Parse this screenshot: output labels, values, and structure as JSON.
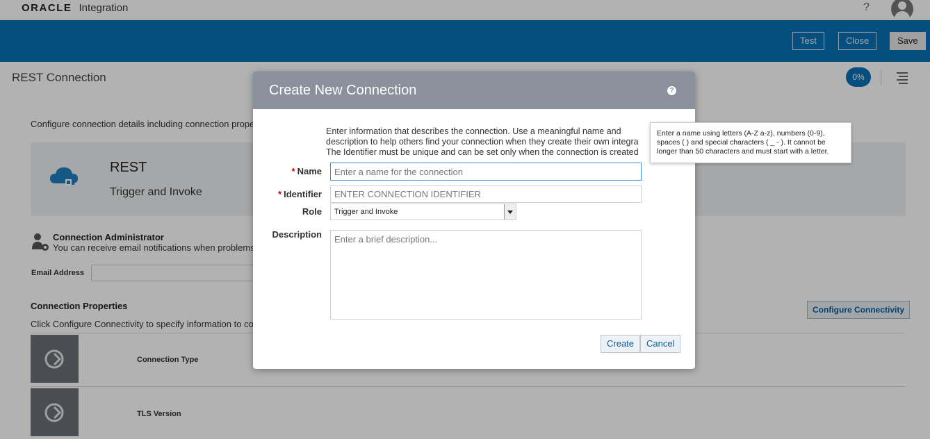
{
  "header": {
    "brand": "ORACLE",
    "product": "Integration",
    "help_label": "?"
  },
  "toolbar": {
    "test_label": "Test",
    "close_label": "Close",
    "save_label": "Save"
  },
  "page": {
    "title": "REST Connection",
    "progress": "0%",
    "intro": "Configure connection details including connection prope",
    "card_title": "REST",
    "card_subtitle": "Trigger and Invoke",
    "admin_title": "Connection Administrator",
    "admin_subtitle": "You can receive email notifications when problems",
    "email_label": "Email Address",
    "props_title": "Connection Properties",
    "props_subtitle": "Click Configure Connectivity to specify information to co",
    "configure_label": "Configure Connectivity",
    "rows": [
      {
        "label": "Connection Type"
      },
      {
        "label": "TLS Version"
      }
    ]
  },
  "dialog": {
    "title": "Create New Connection",
    "help_glyph": "?",
    "description_lines": [
      "Enter information that describes the connection. Use a meaningful name and",
      "description to help others find your connection when they create their own integra",
      "The Identifier must be unique and can be set only when the connection is created"
    ],
    "name_label": "Name",
    "name_placeholder": "Enter a name for the connection",
    "identifier_label": "Identifier",
    "identifier_placeholder": "ENTER CONNECTION IDENTIFIER",
    "role_label": "Role",
    "role_value": "Trigger and Invoke",
    "description_label": "Description",
    "description_placeholder": "Enter a brief description...",
    "required_mark": "*",
    "create_label": "Create",
    "cancel_label": "Cancel"
  },
  "tooltip": {
    "lines": [
      "Enter a name using letters (A-Z a-z), numbers (0-9),",
      "spaces ( ) and special characters ( _ - ). It cannot be",
      "longer than 50 characters and must start with a letter."
    ]
  },
  "colors": {
    "toolbar_blue": "#0a70b5",
    "dialog_header": "#8a909c",
    "link_blue": "#0a5e9c",
    "required_red": "#cc0000"
  }
}
